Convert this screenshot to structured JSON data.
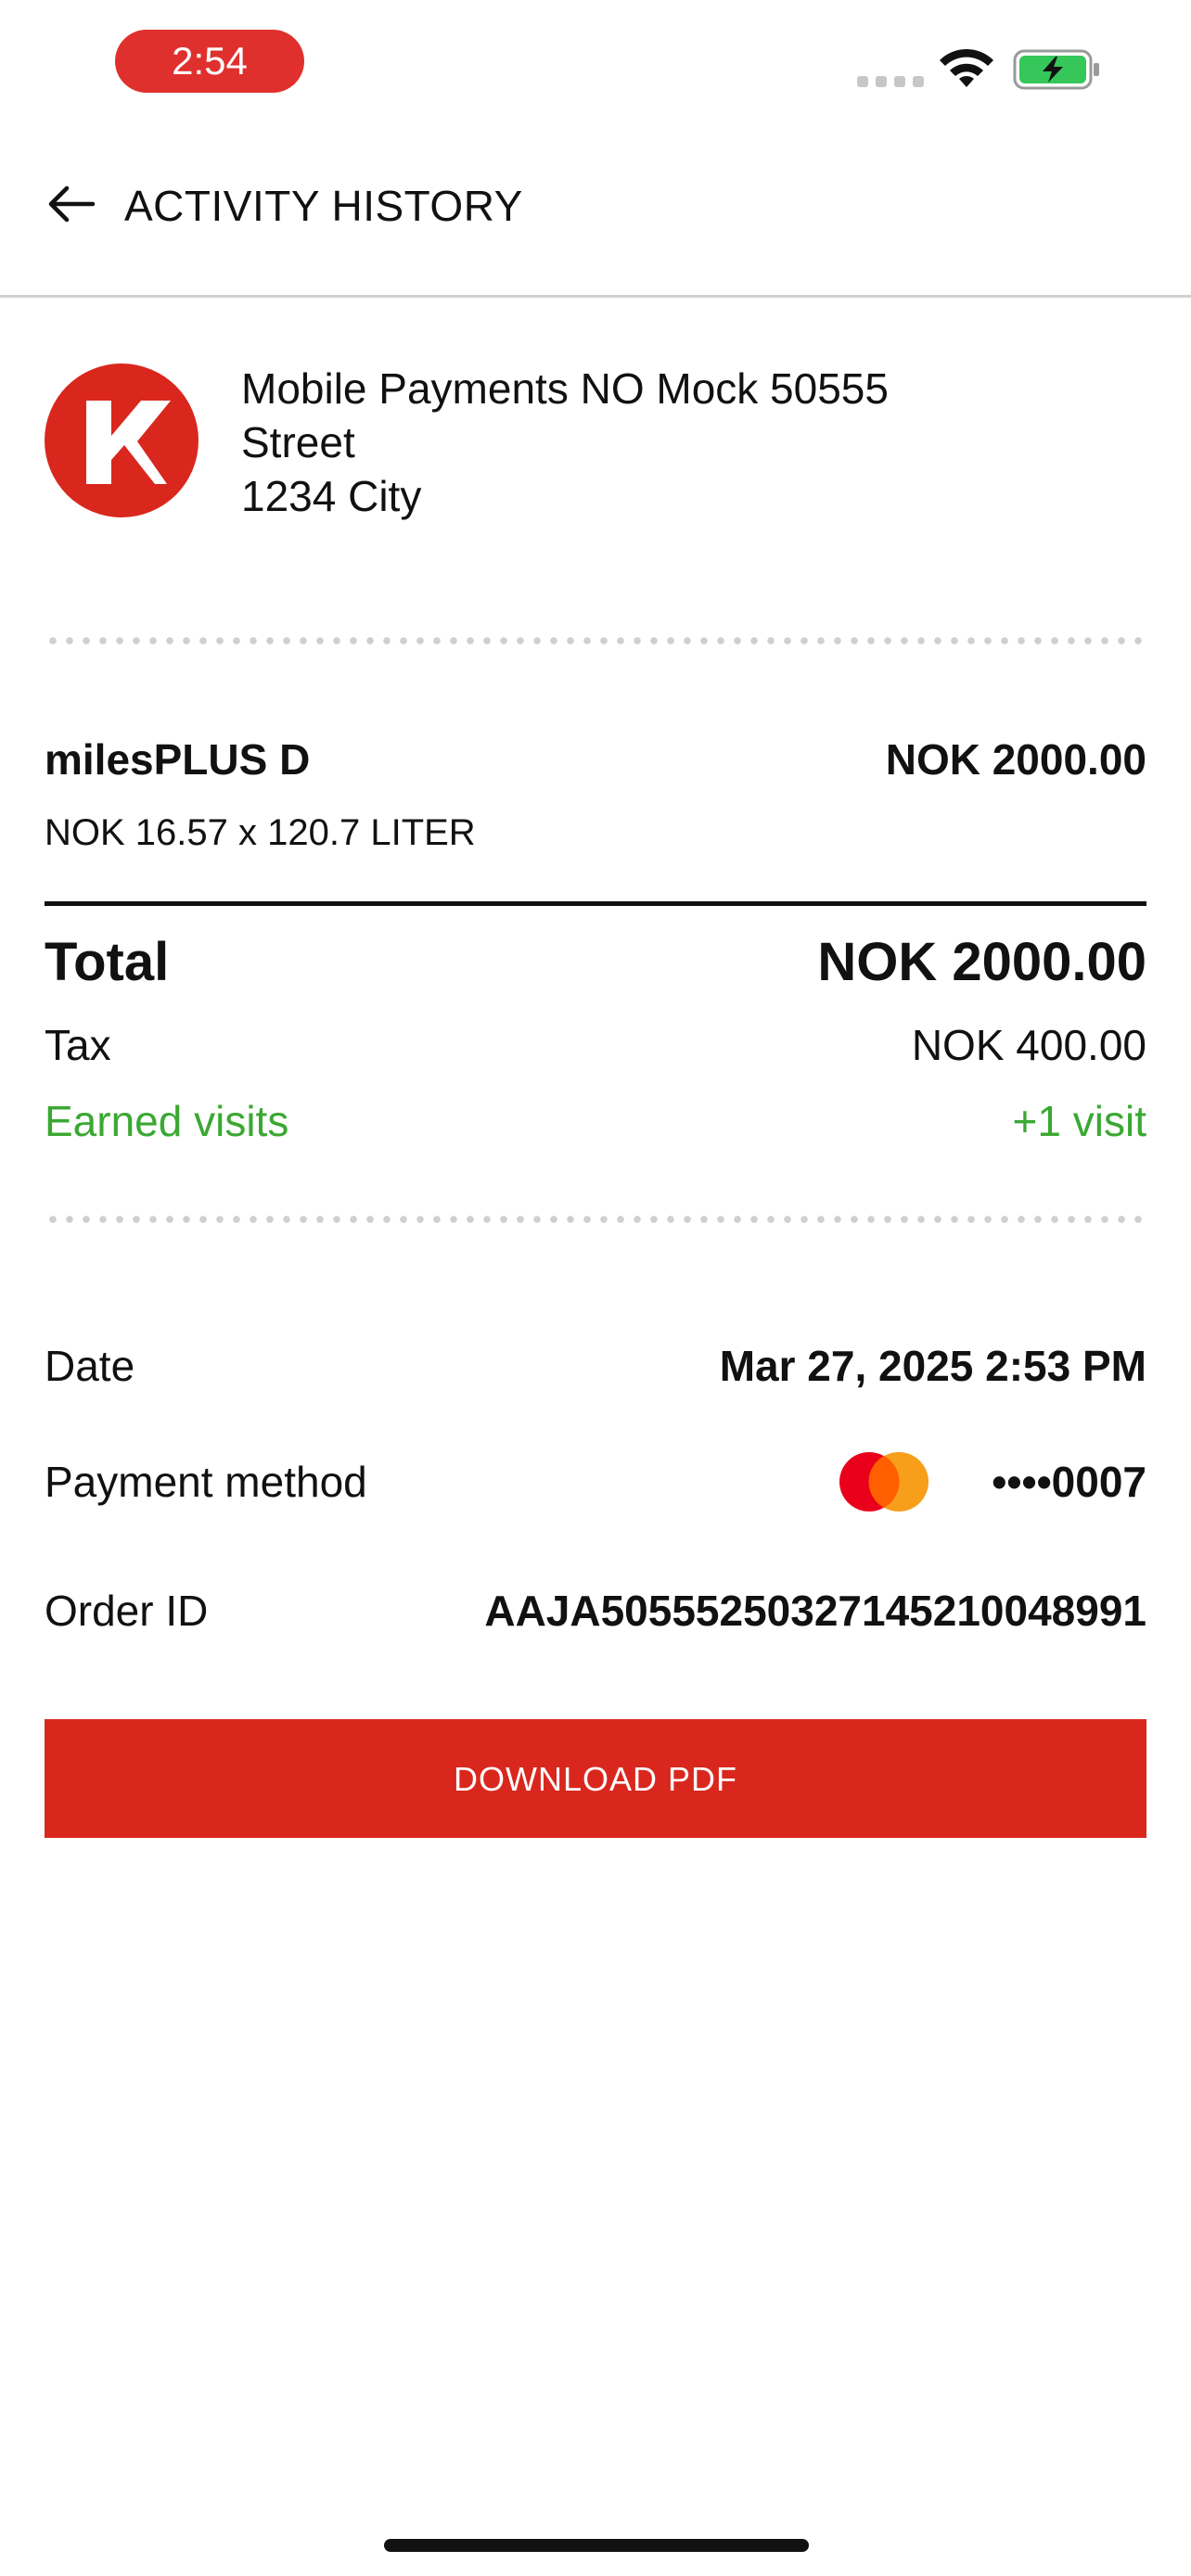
{
  "status_bar": {
    "time": "2:54",
    "colors": {
      "time_pill": "#e0302e",
      "battery_fill": "#35c759"
    },
    "icons": [
      "signal-dots-icon",
      "wifi-icon",
      "battery-charging-icon"
    ]
  },
  "header": {
    "back_icon": "arrow-left-icon",
    "title": "ACTIVITY HISTORY"
  },
  "station": {
    "logo_icon": "circle-k-logo",
    "name": "Mobile Payments NO Mock 50555",
    "street": "Street",
    "city": "1234 City",
    "brand_color": "#d9271e"
  },
  "line_item": {
    "product": "milesPLUS D",
    "amount": "NOK 2000.00",
    "detail": "NOK 16.57 x 120.7 LITER"
  },
  "totals": {
    "total_label": "Total",
    "total_amount": "NOK 2000.00",
    "tax_label": "Tax",
    "tax_amount": "NOK 400.00",
    "visits_label": "Earned visits",
    "visits_value": "+1 visit",
    "visits_color": "#3aa832"
  },
  "details": {
    "date_label": "Date",
    "date_value": "Mar 27, 2025 2:53 PM",
    "payment_label": "Payment method",
    "card_icon": "mastercard-icon",
    "card_number": "••••0007",
    "order_label": "Order ID",
    "order_value": "AAJA505552503271452100489​91"
  },
  "actions": {
    "download_label": "DOWNLOAD PDF",
    "button_color": "#d9271e"
  }
}
